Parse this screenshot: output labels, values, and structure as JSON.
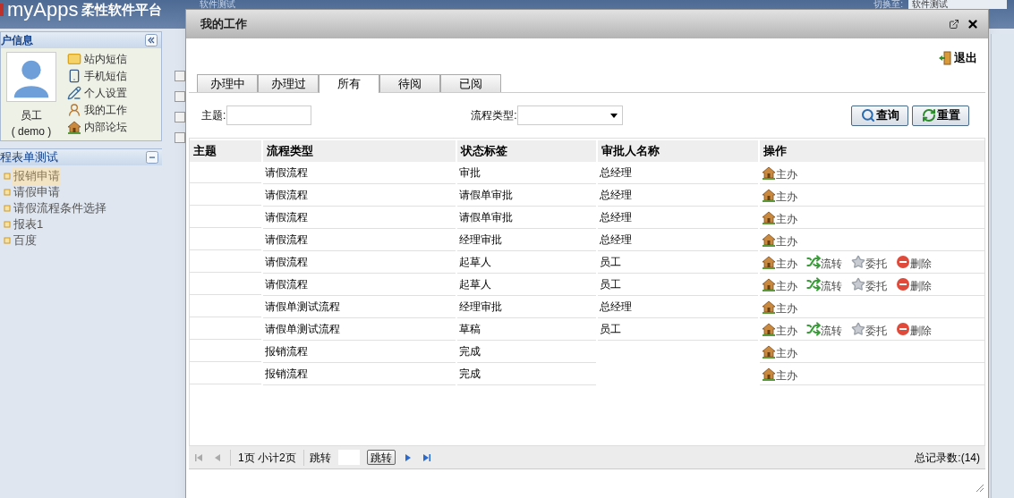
{
  "header": {
    "logo": "myApps",
    "platform": "柔性软件平台",
    "title": "软件测试",
    "switch_label": "切换至:",
    "switch_value": "软件测试"
  },
  "sidebar": {
    "user_panel": {
      "title": "户信息",
      "name": "员工",
      "account": "( demo )",
      "links": [
        {
          "kind": "mail",
          "label": "站内短信"
        },
        {
          "kind": "phone",
          "label": "手机短信"
        },
        {
          "kind": "edit",
          "label": "个人设置"
        },
        {
          "kind": "work",
          "label": "我的工作"
        },
        {
          "kind": "home",
          "label": "内部论坛"
        }
      ]
    },
    "tree_panel": {
      "title": "程表单测试",
      "items": [
        {
          "label": "报销申请",
          "selected": true
        },
        {
          "label": "请假申请",
          "selected": false
        },
        {
          "label": "请假流程条件选择",
          "selected": false
        },
        {
          "label": "报表1",
          "selected": false
        },
        {
          "label": "百度",
          "selected": false
        }
      ]
    }
  },
  "background_list": {
    "checkboxes": [
      {
        "checked": false
      },
      {
        "checked": false
      },
      {
        "checked": false
      },
      {
        "checked": false
      }
    ]
  },
  "dialog": {
    "title": "我的工作",
    "exit": "退出",
    "tabs": [
      {
        "label": "办理中",
        "selected": false
      },
      {
        "label": "办理过",
        "selected": false
      },
      {
        "label": "所有",
        "selected": true
      },
      {
        "label": "待阅",
        "selected": false
      },
      {
        "label": "已阅",
        "selected": false
      }
    ],
    "filters": {
      "subject_label": "主题:",
      "type_label": "流程类型:"
    },
    "buttons": [
      {
        "kind": "search",
        "label": "查询"
      },
      {
        "kind": "reset",
        "label": "重置"
      }
    ],
    "table": {
      "columns": [
        "主题",
        "流程类型",
        "状态标签",
        "审批人名称",
        "操作"
      ],
      "rows": [
        {
          "type": "请假流程",
          "status": "审批",
          "approver": "总经理",
          "actions": [
            {
              "kind": "handle",
              "label": "主办"
            }
          ]
        },
        {
          "type": "请假流程",
          "status": "请假单审批",
          "approver": "总经理",
          "actions": [
            {
              "kind": "handle",
              "label": "主办"
            }
          ]
        },
        {
          "type": "请假流程",
          "status": "请假单审批",
          "approver": "总经理",
          "actions": [
            {
              "kind": "handle",
              "label": "主办"
            }
          ]
        },
        {
          "type": "请假流程",
          "status": "经理审批",
          "approver": "总经理",
          "actions": [
            {
              "kind": "handle",
              "label": "主办"
            }
          ]
        },
        {
          "type": "请假流程",
          "status": "起草人",
          "approver": "员工",
          "actions": [
            {
              "kind": "handle",
              "label": "主办"
            },
            {
              "kind": "transfer",
              "label": "流转"
            },
            {
              "kind": "delegate",
              "label": "委托"
            },
            {
              "kind": "delete",
              "label": "删除"
            }
          ]
        },
        {
          "type": "请假流程",
          "status": "起草人",
          "approver": "员工",
          "actions": [
            {
              "kind": "handle",
              "label": "主办"
            },
            {
              "kind": "transfer",
              "label": "流转"
            },
            {
              "kind": "delegate",
              "label": "委托"
            },
            {
              "kind": "delete",
              "label": "删除"
            }
          ]
        },
        {
          "type": "请假单测试流程",
          "status": "经理审批",
          "approver": "总经理",
          "actions": [
            {
              "kind": "handle",
              "label": "主办"
            }
          ]
        },
        {
          "type": "请假单测试流程",
          "status": "草稿",
          "approver": "员工",
          "actions": [
            {
              "kind": "handle",
              "label": "主办"
            },
            {
              "kind": "transfer",
              "label": "流转"
            },
            {
              "kind": "delegate",
              "label": "委托"
            },
            {
              "kind": "delete",
              "label": "删除"
            }
          ]
        },
        {
          "type": "报销流程",
          "status": "完成",
          "actions": [
            {
              "kind": "handle",
              "label": "主办"
            }
          ]
        },
        {
          "type": "报销流程",
          "status": "完成",
          "actions": [
            {
              "kind": "handle",
              "label": "主办"
            }
          ]
        }
      ]
    },
    "pager": {
      "pages": "1页 小计2页",
      "jump_label": "跳转",
      "jump_button": "跳转",
      "total": "总记录数:(14)"
    }
  }
}
